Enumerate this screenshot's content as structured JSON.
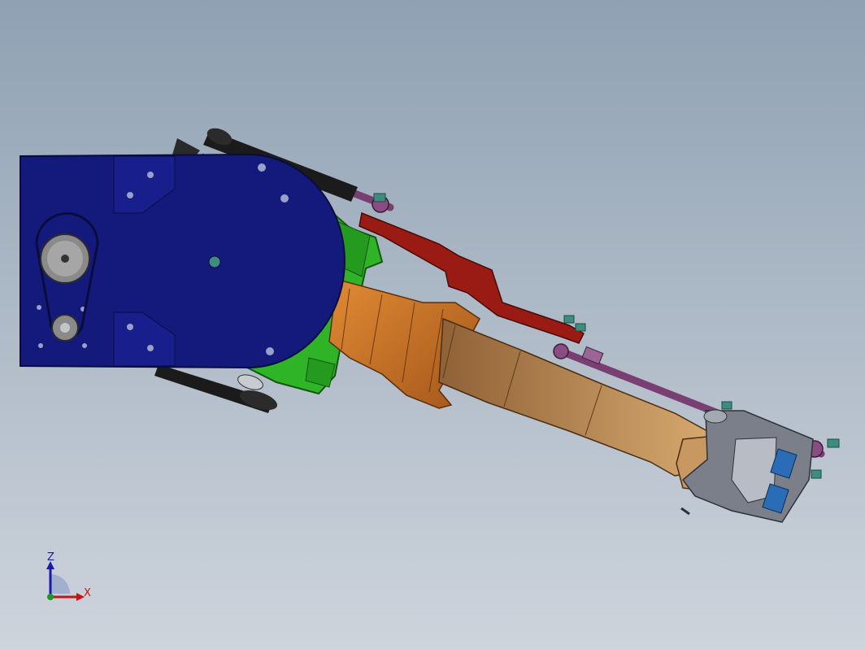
{
  "viewport": {
    "background_top": "#8fa1b3",
    "background_bottom": "#ced4dc"
  },
  "colors": {
    "base_blue": "#141a7c",
    "base_blue_edge": "#0a0d3c",
    "shoulder_green": "#2fb428",
    "upper_arm_orange": "#c26d22",
    "forearm_tan": "#b98855",
    "link_red": "#9a1b14",
    "rod_purple": "#7a3f72",
    "wrist_grey": "#7b7f8a",
    "actuator_blue": "#2a6cb5",
    "belt_black": "#1b1b1b",
    "hardware_teal": "#3e8c7e"
  },
  "model": {
    "parts": [
      "base-plate",
      "drive-pulley",
      "idler-pulley",
      "timing-belt",
      "shoulder-housing",
      "upper-arm",
      "forearm",
      "parallel-link",
      "tie-rod",
      "wrist-bracket",
      "end-effector-actuator"
    ]
  },
  "triad": {
    "z_label": "Z",
    "x_label": "X",
    "z_color": "#1a1aa8",
    "x_color": "#c81414",
    "y_color": "#1a9a1a"
  }
}
